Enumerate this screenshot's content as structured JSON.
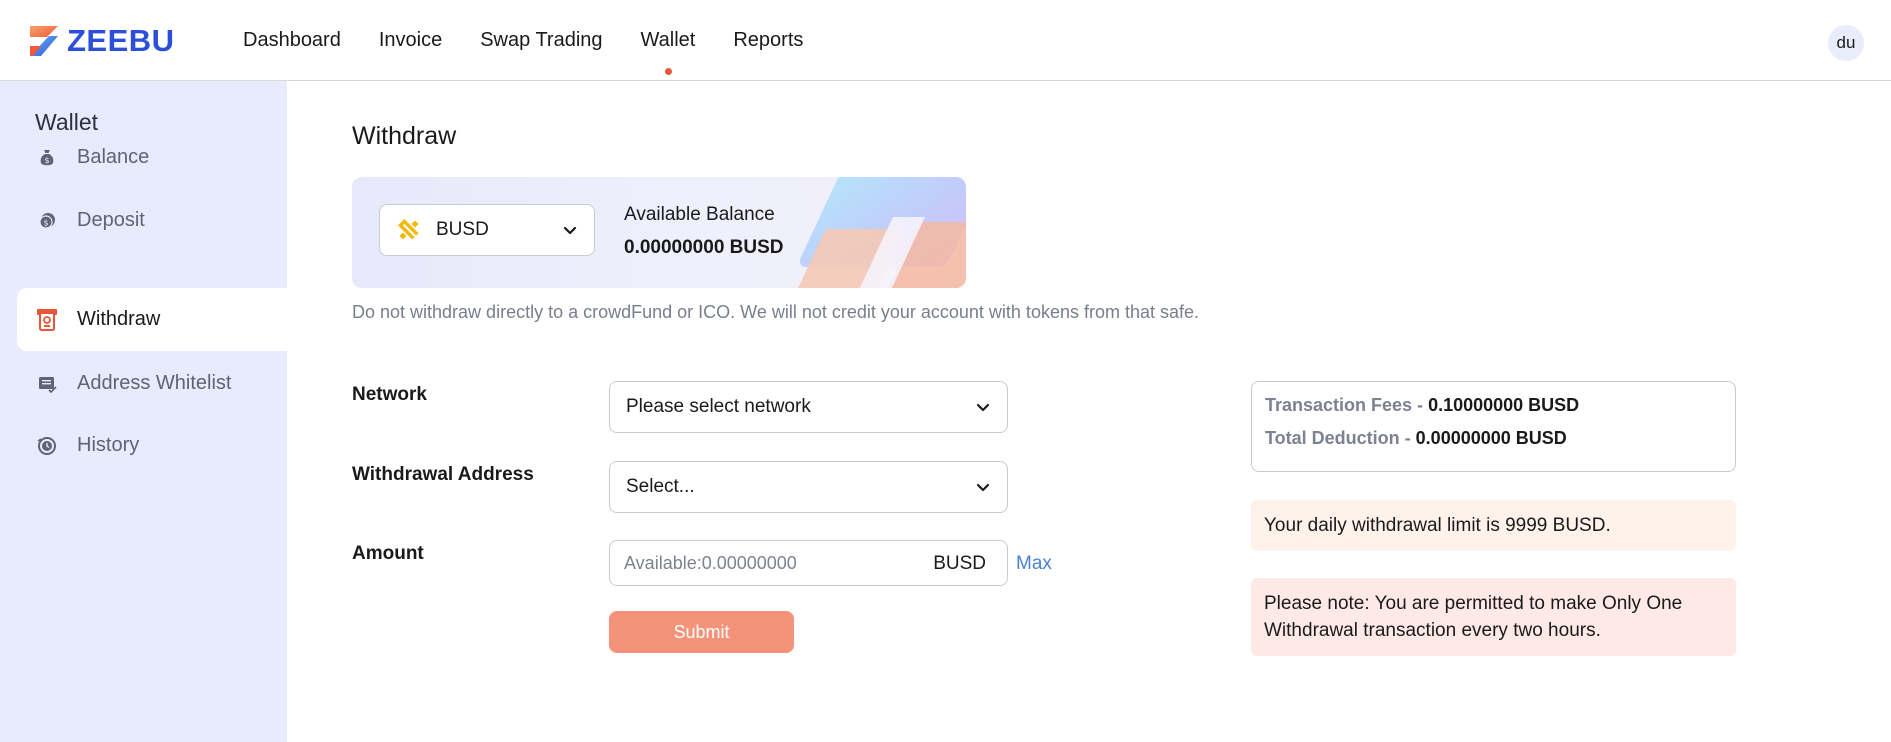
{
  "app": {
    "brand": "ZEEBU",
    "brand_color": "#2b4fd8",
    "accent_color": "#e8553a"
  },
  "nav": {
    "items": [
      {
        "label": "Dashboard"
      },
      {
        "label": "Invoice"
      },
      {
        "label": "Swap Trading"
      },
      {
        "label": "Wallet",
        "active": true
      },
      {
        "label": "Reports"
      }
    ]
  },
  "user": {
    "avatar_initials": "du"
  },
  "sidebar": {
    "title": "Wallet",
    "items": [
      {
        "label": "Balance",
        "icon": "money-bag-icon"
      },
      {
        "label": "Deposit",
        "icon": "coins-icon"
      },
      {
        "label": "Withdraw",
        "icon": "atm-withdraw-icon",
        "active": true
      },
      {
        "label": "Address Whitelist",
        "icon": "address-book-icon"
      },
      {
        "label": "History",
        "icon": "history-clock-icon"
      }
    ]
  },
  "main": {
    "title": "Withdraw",
    "balance_card": {
      "coin": "BUSD",
      "coin_icon": "busd-icon",
      "available_label": "Available Balance",
      "available_value": "0.00000000 BUSD"
    },
    "warning": "Do not withdraw directly to a crowdFund or ICO. We will not credit your account with tokens from that safe.",
    "form": {
      "network_label": "Network",
      "network_value": "Please select network",
      "address_label": "Withdrawal Address",
      "address_value": "Select...",
      "amount_label": "Amount",
      "amount_placeholder": "Available:0.00000000",
      "amount_unit": "BUSD",
      "max_label": "Max",
      "submit_label": "Submit"
    },
    "fees": {
      "transaction_fees_label": "Transaction Fees -",
      "transaction_fees_value": "0.10000000 BUSD",
      "total_deduction_label": "Total Deduction -",
      "total_deduction_value": "0.00000000 BUSD"
    },
    "limit_notice": "Your daily withdrawal limit is 9999 BUSD.",
    "frequency_notice": "Please note: You are permitted to make Only One Withdrawal transaction every two hours."
  }
}
